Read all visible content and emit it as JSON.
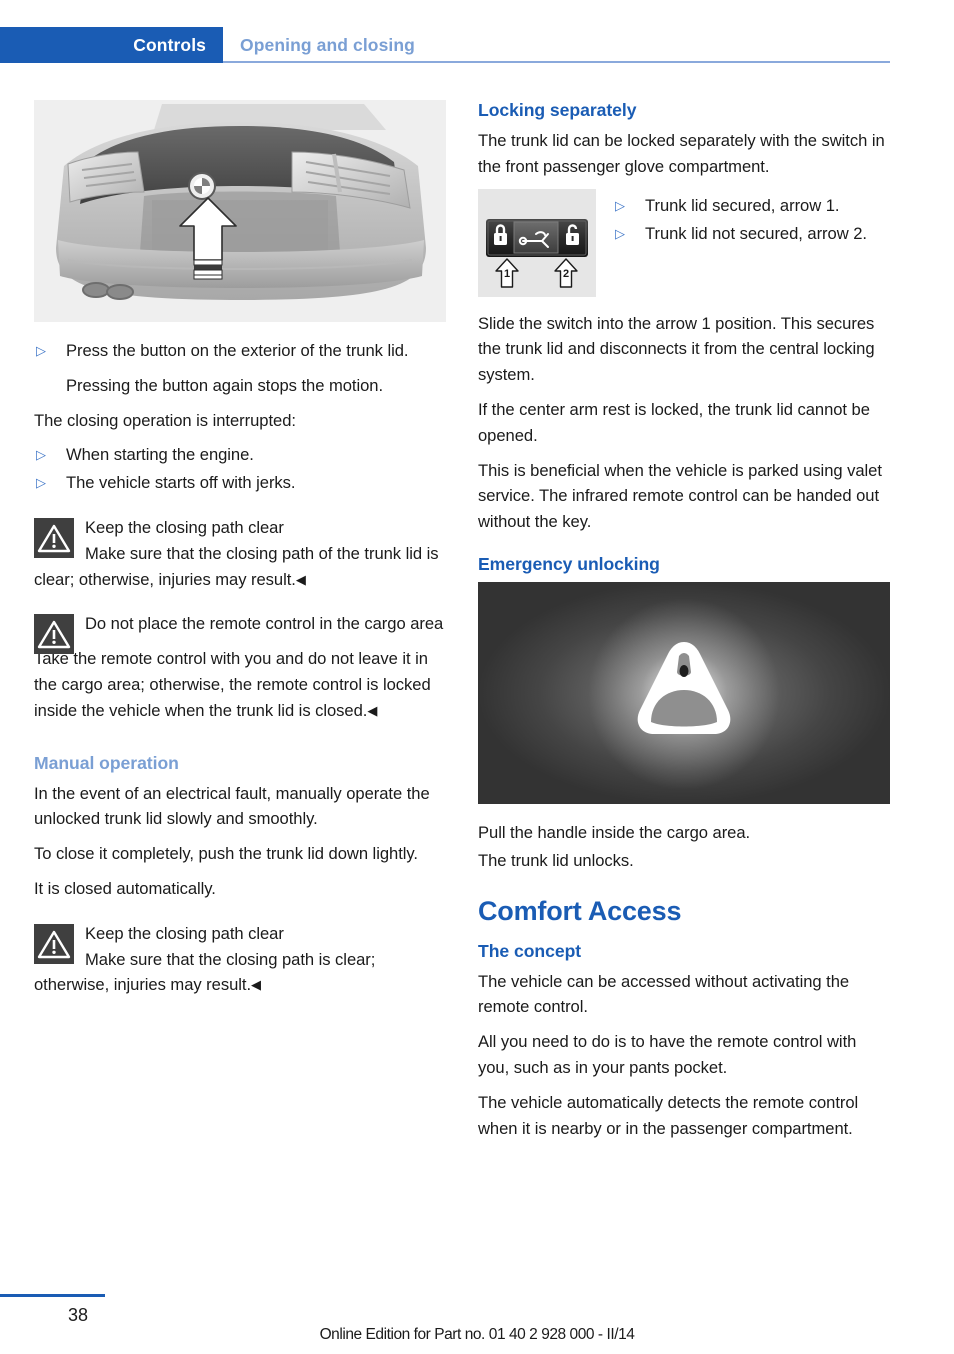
{
  "header": {
    "chapter_tab": "Controls",
    "section": "Opening and closing"
  },
  "left_column": {
    "car_image_alt": "BMW sedan rear view with arrow pointing at trunk lid button",
    "list_1": [
      {
        "marker": "▷",
        "text": "Press the button on the exterior of the trunk lid.",
        "sub": "Pressing the button again stops the motion."
      }
    ],
    "paragraph_interrupted": "The closing operation is interrupted:",
    "list_2": [
      {
        "marker": "▷",
        "text": "When starting the engine."
      },
      {
        "marker": "▷",
        "text": "The vehicle starts off with jerks."
      }
    ],
    "warning_1": {
      "icon": "warning-triangle-icon",
      "title": "Keep the closing path clear",
      "lead": "Make sure that the closing path of the",
      "rest": "trunk lid is clear; otherwise, injuries may result.",
      "tail": "◀"
    },
    "warning_2": {
      "icon": "warning-triangle-icon",
      "title": "Do not place the remote control in the cargo area",
      "body": "Take the remote control with you and do not leave it in the cargo area; otherwise, the remote control is locked inside the vehicle when the trunk lid is closed.",
      "tail": "◀"
    },
    "manual_operation": {
      "heading": "Manual operation",
      "p1": "In the event of an electrical fault, manually operate the unlocked trunk lid slowly and smoothly.",
      "p2": "To close it completely, push the trunk lid down lightly.",
      "p3": "It is closed automatically."
    },
    "warning_3": {
      "icon": "warning-triangle-icon",
      "title": "Keep the closing path clear",
      "lead": "Make sure that the closing path is clear;",
      "rest": "otherwise, injuries may result.",
      "tail": "◀"
    }
  },
  "right_column": {
    "locking_separately": {
      "heading": "Locking separately",
      "p1": "The trunk lid can be locked separately with the switch in the front passenger glove compartment.",
      "switch_image_alt": "Glove compartment trunk lock switch with arrows 1 and 2",
      "switch_arrow_1_label": "1",
      "switch_arrow_2_label": "2",
      "bullets": [
        {
          "marker": "▷",
          "text": "Trunk lid secured, arrow 1."
        },
        {
          "marker": "▷",
          "text": "Trunk lid not secured, arrow 2."
        }
      ],
      "p2": "Slide the switch into the arrow 1 position. This secures the trunk lid and disconnects it from the central locking system.",
      "p3": "If the center arm rest is locked, the trunk lid cannot be opened.",
      "p4": "This is beneficial when the vehicle is parked using valet service. The infrared remote control can be handed out without the key."
    },
    "emergency_unlocking": {
      "heading": "Emergency unlocking",
      "image_alt": "Illuminated emergency release handle inside the cargo area",
      "p1": "Pull the handle inside the cargo area.",
      "p2": "The trunk lid unlocks."
    },
    "comfort_access": {
      "chapter": "Comfort Access",
      "subheading": "The concept",
      "p1": "The vehicle can be accessed without activating the remote control.",
      "p2": "All you need to do is to have the remote control with you, such as in your pants pocket.",
      "p3": "The vehicle automatically detects the remote control when it is nearby or in the passenger compartment."
    }
  },
  "footer": {
    "page_number": "38",
    "note": "Online Edition for Part no. 01 40 2 928 000 - II/14"
  },
  "colors": {
    "brand_blue": "#1a5cb4",
    "light_blue": "#7a9fd4",
    "bullet_blue": "#3f76c8",
    "warn_box": "#3f3f3f",
    "text": "#1b1b1b"
  }
}
